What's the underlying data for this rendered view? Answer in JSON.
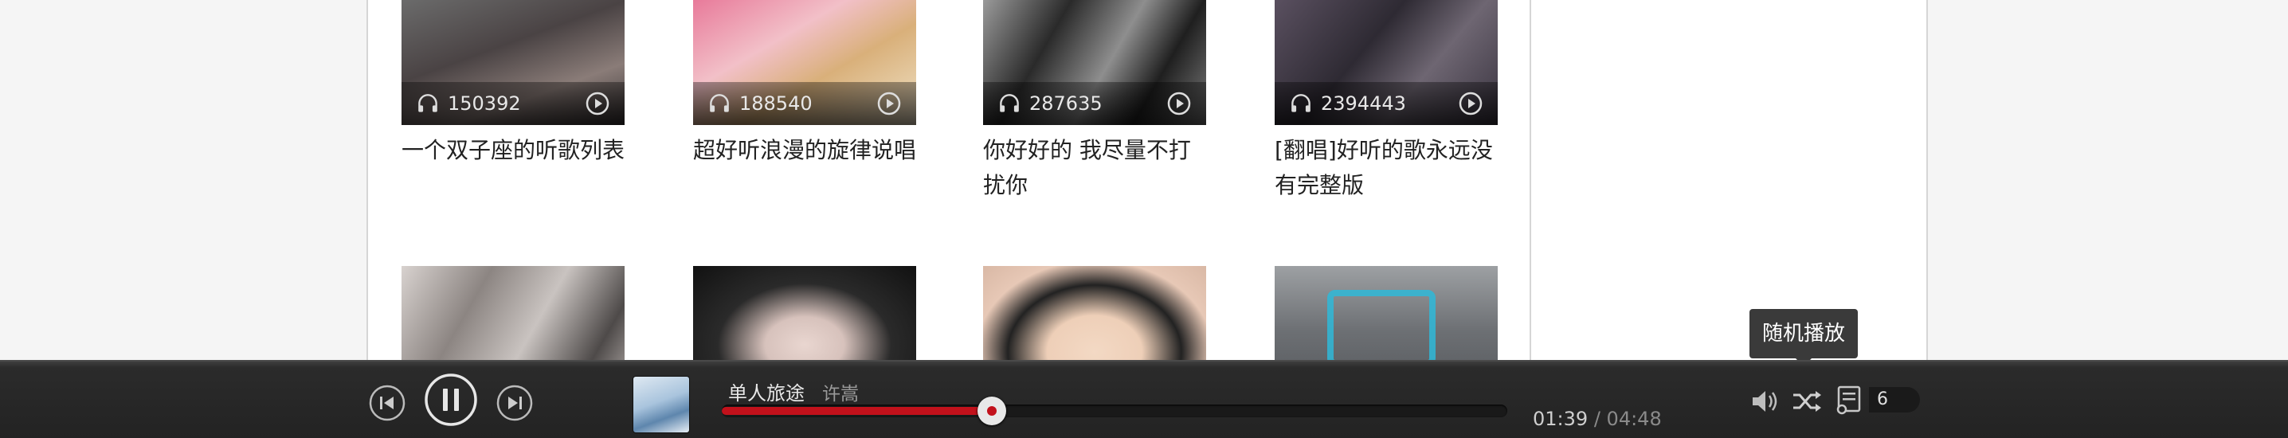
{
  "playlists_row1": [
    {
      "plays": "150392",
      "title": "一个双子座的听歌列表"
    },
    {
      "plays": "188540",
      "title": "超好听浪漫的旋律说唱"
    },
    {
      "plays": "287635",
      "title": "你好好的 我尽量不打扰你"
    },
    {
      "plays": "2394443",
      "title": "[翻唱]好听的歌永远没有完整版"
    }
  ],
  "player": {
    "song_title": "单人旅途",
    "artist": "许嵩",
    "current_time": "01:39",
    "separator": "/",
    "total_time": "04:48",
    "progress_fraction": 0.3437,
    "playlist_count": "6",
    "tooltip": "随机播放",
    "accent_color": "#c2111b"
  },
  "icons": {
    "prev": "prev-track-icon",
    "pause": "pause-icon",
    "next": "next-track-icon",
    "volume": "volume-icon",
    "shuffle": "shuffle-icon",
    "playlist": "playlist-icon",
    "headphones": "headphones-icon",
    "play": "play-icon"
  }
}
